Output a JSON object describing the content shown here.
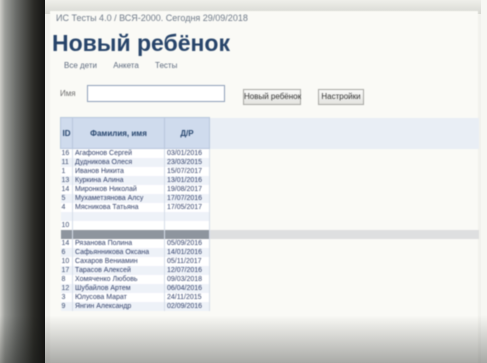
{
  "window": {
    "title": "ИС Тесты 4.0 / ВСЯ-2000. Сегодня 29/09/2018"
  },
  "page": {
    "title": "Новый ребёнок"
  },
  "nav": {
    "items": [
      "Все дети",
      "Анкета",
      "Тесты"
    ]
  },
  "form": {
    "name_label": "Имя",
    "name_value": "",
    "name_placeholder": ""
  },
  "buttons": {
    "new_child": "Новый ребёнок",
    "settings": "Настройки"
  },
  "table": {
    "columns": [
      "ID",
      "Фамилия, имя",
      "Д/Р"
    ],
    "selected_index": 9,
    "rows": [
      {
        "id": "16",
        "name": "Агафонов Сергей",
        "dob": "03/01/2016"
      },
      {
        "id": "11",
        "name": "Дудникова Олеся",
        "dob": "23/03/2015"
      },
      {
        "id": "1",
        "name": "Иванов Никита",
        "dob": "15/07/2017"
      },
      {
        "id": "13",
        "name": "Куркина Алина",
        "dob": "13/01/2016"
      },
      {
        "id": "14",
        "name": "Миронков Николай",
        "dob": "19/08/2017"
      },
      {
        "id": "5",
        "name": "Мухаметзянова Алсу",
        "dob": "17/07/2016"
      },
      {
        "id": "4",
        "name": "Мясникова Татьяна",
        "dob": "17/05/2017"
      },
      {
        "id": "",
        "name": "",
        "dob": ""
      },
      {
        "id": "10",
        "name": "",
        "dob": ""
      },
      {
        "id": "",
        "name": "",
        "dob": ""
      },
      {
        "id": "14",
        "name": "Рязанова Полина",
        "dob": "05/09/2016"
      },
      {
        "id": "6",
        "name": "Сафьянникова Оксана",
        "dob": "14/01/2016"
      },
      {
        "id": "10",
        "name": "Сахаров Вениамин",
        "dob": "05/11/2017"
      },
      {
        "id": "17",
        "name": "Тарасов Алексей",
        "dob": "12/07/2016"
      },
      {
        "id": "8",
        "name": "Хомяченко Любовь",
        "dob": "09/03/2018"
      },
      {
        "id": "12",
        "name": "Шубайлов Артем",
        "dob": "06/04/2016"
      },
      {
        "id": "3",
        "name": "Юлусова Марат",
        "dob": "24/11/2015"
      },
      {
        "id": "9",
        "name": "Янгин Александр",
        "dob": "02/09/2016"
      }
    ]
  }
}
